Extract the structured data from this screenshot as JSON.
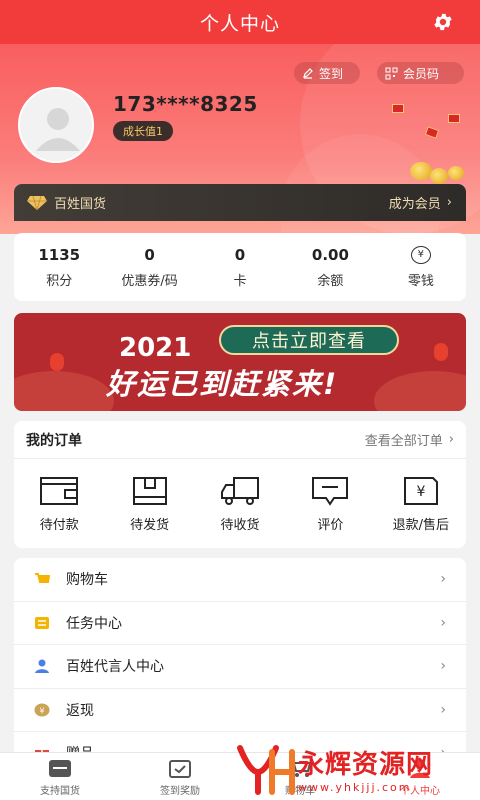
{
  "header": {
    "title": "个人中心",
    "settings_icon": "gear-icon"
  },
  "profile": {
    "sign_label": "签到",
    "member_code_label": "会员码",
    "phone": "173****8325",
    "growth_label": "成长值1"
  },
  "member_bar": {
    "brand": "百姓国货",
    "join_label": "成为会员",
    "chevron": "›"
  },
  "stats": [
    {
      "value": "1135",
      "label": "积分"
    },
    {
      "value": "0",
      "label": "优惠券/码"
    },
    {
      "value": "0",
      "label": "卡"
    },
    {
      "value": "0.00",
      "label": "余额"
    },
    {
      "value": "",
      "label": "零钱",
      "icon": "¥"
    }
  ],
  "banner": {
    "year": "2021",
    "button": "点击立即查看",
    "slogan": "好运已到赶紧来!"
  },
  "orders": {
    "title": "我的订单",
    "view_all": "查看全部订单",
    "chevron": "›",
    "items": [
      {
        "label": "待付款",
        "icon": "wallet-icon"
      },
      {
        "label": "待发货",
        "icon": "box-icon"
      },
      {
        "label": "待收货",
        "icon": "truck-icon"
      },
      {
        "label": "评价",
        "icon": "comment-icon"
      },
      {
        "label": "退款/售后",
        "icon": "refund-icon"
      }
    ]
  },
  "menu": [
    {
      "label": "购物车",
      "icon": "cart-icon",
      "color": "#f5b400"
    },
    {
      "label": "任务中心",
      "icon": "task-icon",
      "color": "#f5b400"
    },
    {
      "label": "百姓代言人中心",
      "icon": "person-icon",
      "color": "#4a7ee8"
    },
    {
      "label": "返现",
      "icon": "cashback-icon",
      "color": "#caa355"
    },
    {
      "label": "赠品",
      "icon": "gift-icon",
      "color": "#e04a3a"
    }
  ],
  "tabbar": [
    {
      "label": "支持国货",
      "icon": "store-icon"
    },
    {
      "label": "签到奖励",
      "icon": "checkin-icon"
    },
    {
      "label": "购物车",
      "icon": "cart-icon"
    },
    {
      "label": "个人中心",
      "icon": "user-icon"
    }
  ],
  "watermark": {
    "text": "永辉资源网",
    "url": "www.yhkjjj.com"
  },
  "colors": {
    "primary": "#f23b3b",
    "member_gold": "#f1ddb5"
  }
}
